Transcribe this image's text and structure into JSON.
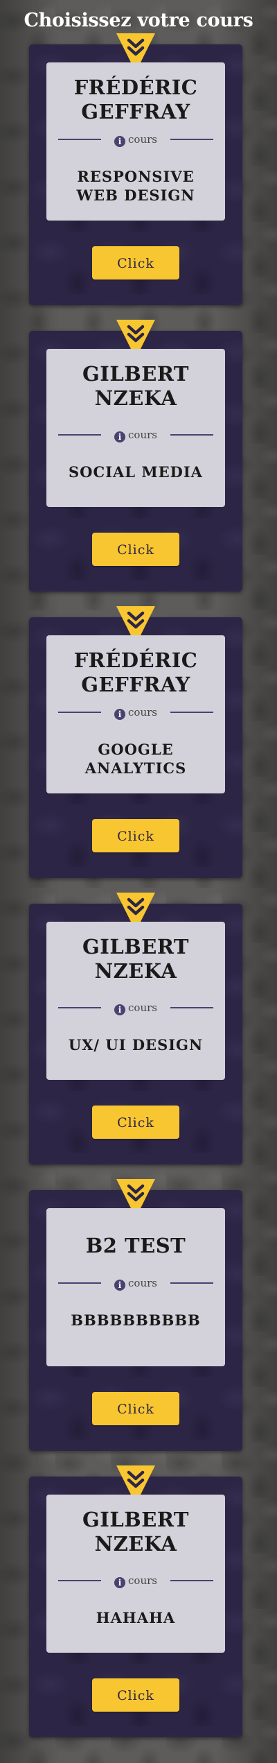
{
  "page": {
    "title": "Choisissez votre cours"
  },
  "colors": {
    "card_bg": "#2c2545",
    "inner_bg": "#d3d1d9",
    "accent": "#f8c630",
    "divider": "#4a4170"
  },
  "courses": [
    {
      "instructor_line1": "FRÉDÉRIC",
      "instructor_line2": "GEFFRAY",
      "label": "cours",
      "title_line1": "RESPONSIVE",
      "title_line2": "WEB DESIGN",
      "button": "Click",
      "icon": "chevron-double-down-icon"
    },
    {
      "instructor_line1": "GILBERT",
      "instructor_line2": "NZEKA",
      "label": "cours",
      "title_line1": "SOCIAL MEDIA",
      "title_line2": "",
      "button": "Click",
      "icon": "chevron-double-down-icon"
    },
    {
      "instructor_line1": "FRÉDÉRIC",
      "instructor_line2": "GEFFRAY",
      "label": "cours",
      "title_line1": "GOOGLE",
      "title_line2": "ANALYTICS",
      "button": "Click",
      "icon": "chevron-double-down-icon"
    },
    {
      "instructor_line1": "GILBERT",
      "instructor_line2": "NZEKA",
      "label": "cours",
      "title_line1": "UX/ UI DESIGN",
      "title_line2": "",
      "button": "Click",
      "icon": "chevron-double-down-icon"
    },
    {
      "instructor_line1": "B2 TEST",
      "instructor_line2": "",
      "label": "cours",
      "title_line1": "BBBBBBBBBB",
      "title_line2": "",
      "button": "Click",
      "icon": "chevron-double-down-icon"
    },
    {
      "instructor_line1": "GILBERT",
      "instructor_line2": "NZEKA",
      "label": "cours",
      "title_line1": "HAHAHA",
      "title_line2": "",
      "button": "Click",
      "icon": "chevron-double-down-icon"
    }
  ]
}
